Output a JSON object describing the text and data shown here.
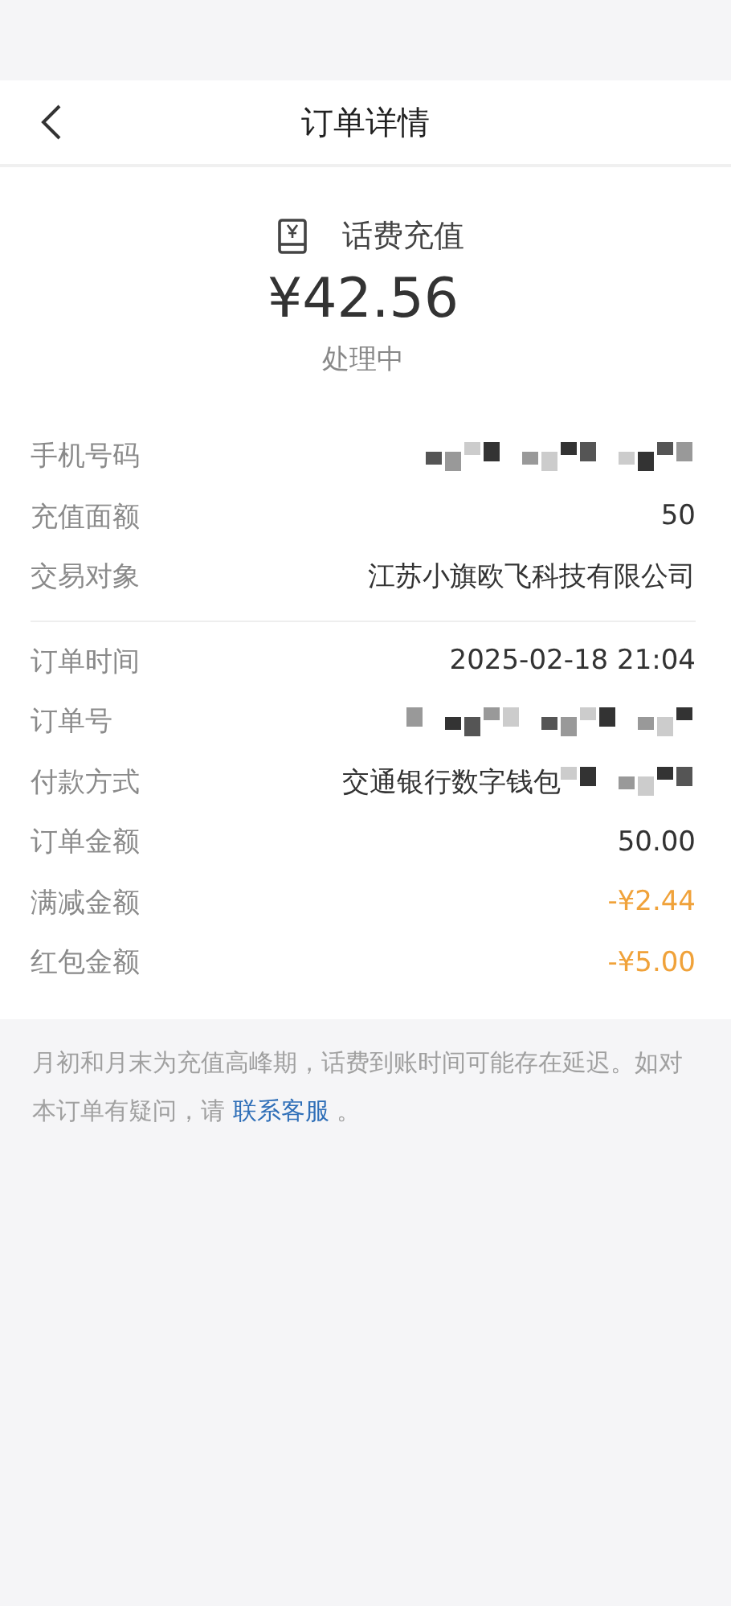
{
  "header": {
    "title": "订单详情"
  },
  "summary": {
    "service": "话费充值",
    "amount": "¥42.56",
    "status": "处理中"
  },
  "sections": [
    {
      "rows": [
        {
          "label": "手机号码",
          "kind": "masked"
        },
        {
          "label": "充值面额",
          "value": "50",
          "kind": "plain"
        },
        {
          "label": "交易对象",
          "value": "江苏小旗欧飞科技有限公司",
          "kind": "plain"
        }
      ]
    },
    {
      "rows": [
        {
          "label": "订单时间",
          "value": "2025-02-18 21:04",
          "kind": "plain"
        },
        {
          "label": "订单号",
          "kind": "masked"
        },
        {
          "label": "付款方式",
          "value": "交通银行数字钱包",
          "kind": "partly_masked"
        },
        {
          "label": "订单金额",
          "value": "50.00",
          "kind": "plain"
        },
        {
          "label": "满减金额",
          "value": "-¥2.44",
          "kind": "discount"
        },
        {
          "label": "红包金额",
          "value": "-¥5.00",
          "kind": "discount"
        }
      ]
    }
  ],
  "note": {
    "text": "月初和月末为充值高峰期，话费到账时间可能存在延迟。如对本订单有疑问，请 ",
    "link": "联系客服",
    "end": " 。"
  }
}
